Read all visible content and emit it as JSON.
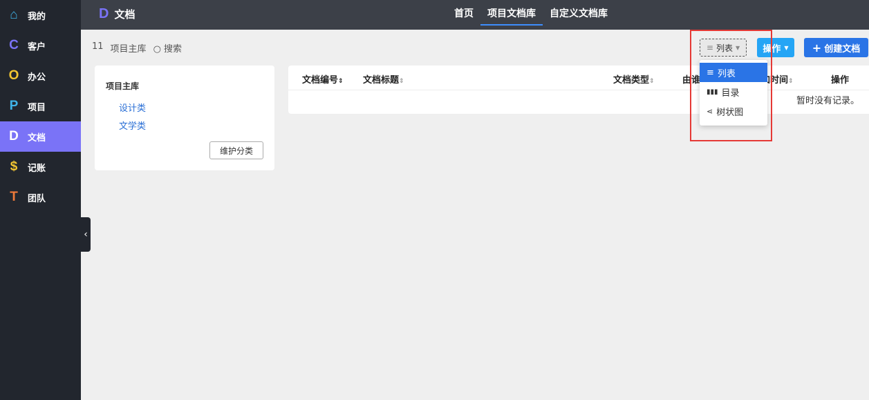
{
  "sidebar": {
    "items": [
      {
        "label": "我的",
        "icon": "home-icon",
        "glyph": "⌂",
        "color": "#3fb3e8"
      },
      {
        "label": "客户",
        "icon": "c-icon",
        "glyph": "C",
        "color": "#7a73f7"
      },
      {
        "label": "办公",
        "icon": "o-icon",
        "glyph": "O",
        "color": "#f2c531"
      },
      {
        "label": "项目",
        "icon": "p-icon",
        "glyph": "P",
        "color": "#3fb3e8"
      },
      {
        "label": "文档",
        "icon": "d-icon",
        "glyph": "D",
        "color": "#ffffff"
      },
      {
        "label": "记账",
        "icon": "dollar-icon",
        "glyph": "$",
        "color": "#f2c531"
      },
      {
        "label": "团队",
        "icon": "t-icon",
        "glyph": "T",
        "color": "#f07a3a"
      }
    ]
  },
  "header": {
    "logo": "D",
    "title": "文档",
    "tabs": [
      "首页",
      "项目文档库",
      "自定义文档库"
    ]
  },
  "breadcrumb": {
    "count": "11",
    "library": "项目主库",
    "search": "搜索"
  },
  "toolbar": {
    "view": "列表",
    "operate": "操作",
    "create": "创建文档"
  },
  "panel": {
    "title": "项目主库",
    "categories": [
      "设计类",
      "文学类"
    ],
    "maintain": "维护分类"
  },
  "table": {
    "headers": [
      "文档编号",
      "文档标题",
      "文档类型",
      "由谁添加",
      "添加时间",
      "操作"
    ],
    "empty": "暂时没有记录。"
  },
  "dropdown": {
    "items": [
      "列表",
      "目录",
      "树状图"
    ]
  }
}
